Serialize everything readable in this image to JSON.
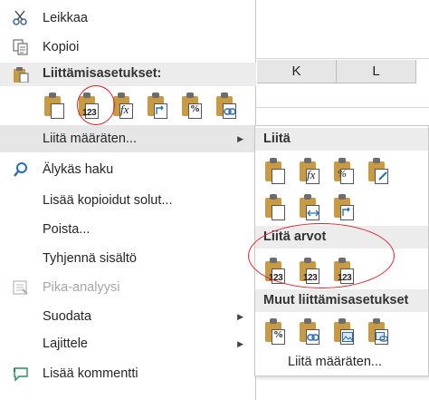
{
  "sheet": {
    "columns": [
      "K",
      "L"
    ]
  },
  "menu": {
    "cut": "Leikkaa",
    "copy": "Kopioi",
    "paste_options_title": "Liittämisasetukset:",
    "paste_special": "Liitä määräten...",
    "smart_lookup": "Älykäs haku",
    "insert_copied": "Lisää kopioidut solut...",
    "delete": "Poista...",
    "clear_contents": "Tyhjennä sisältö",
    "quick_analysis": "Pika-analyysi",
    "filter": "Suodata",
    "sort": "Lajittele",
    "add_comment": "Lisää kommentti"
  },
  "submenu": {
    "paste_title": "Liitä",
    "paste_values_title": "Liitä arvot",
    "other_options_title": "Muut liittämisasetukset",
    "paste_special": "Liitä määräten..."
  },
  "icons": {
    "cut": "scissors-icon",
    "copy": "copy-icon",
    "paste": "clipboard-icon",
    "smart_lookup": "search-icon",
    "quick_analysis": "quick-analysis-icon",
    "comment": "comment-icon",
    "values_badge": "123",
    "formula_badge": "fx",
    "percent_badge": "%"
  },
  "colors": {
    "highlight_ring": "#d9262e",
    "clipboard": "#c89a44",
    "section_bg": "#ececec"
  }
}
